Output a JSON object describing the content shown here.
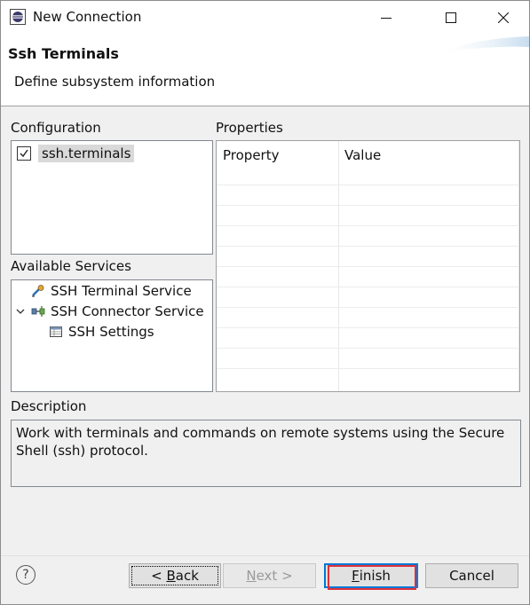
{
  "window": {
    "title": "New Connection"
  },
  "banner": {
    "title": "Ssh Terminals",
    "description": "Define subsystem information"
  },
  "configuration": {
    "label": "Configuration",
    "items": [
      {
        "label": "ssh.terminals",
        "checked": true
      }
    ]
  },
  "available_services": {
    "label": "Available Services",
    "items": [
      {
        "label": "SSH Terminal Service",
        "icon": "terminal-service-icon"
      },
      {
        "label": "SSH Connector Service",
        "icon": "connector-service-icon",
        "expanded": true
      },
      {
        "label": "SSH Settings",
        "icon": "settings-table-icon"
      }
    ]
  },
  "properties": {
    "label": "Properties",
    "columns": [
      "Property",
      "Value"
    ],
    "rows": []
  },
  "description": {
    "label": "Description",
    "text": "Work with terminals and commands on remote systems using the Secure Shell (ssh) protocol."
  },
  "buttons": {
    "back_prefix": "< ",
    "back_mnemonic": "B",
    "back_rest": "ack",
    "next_mnemonic": "N",
    "next_rest": "ext >",
    "finish_mnemonic": "F",
    "finish_rest": "inish",
    "cancel": "Cancel"
  },
  "help": {
    "glyph": "?"
  },
  "colors": {
    "highlight_border": "#e0303a",
    "primary_border": "#0078d7"
  }
}
